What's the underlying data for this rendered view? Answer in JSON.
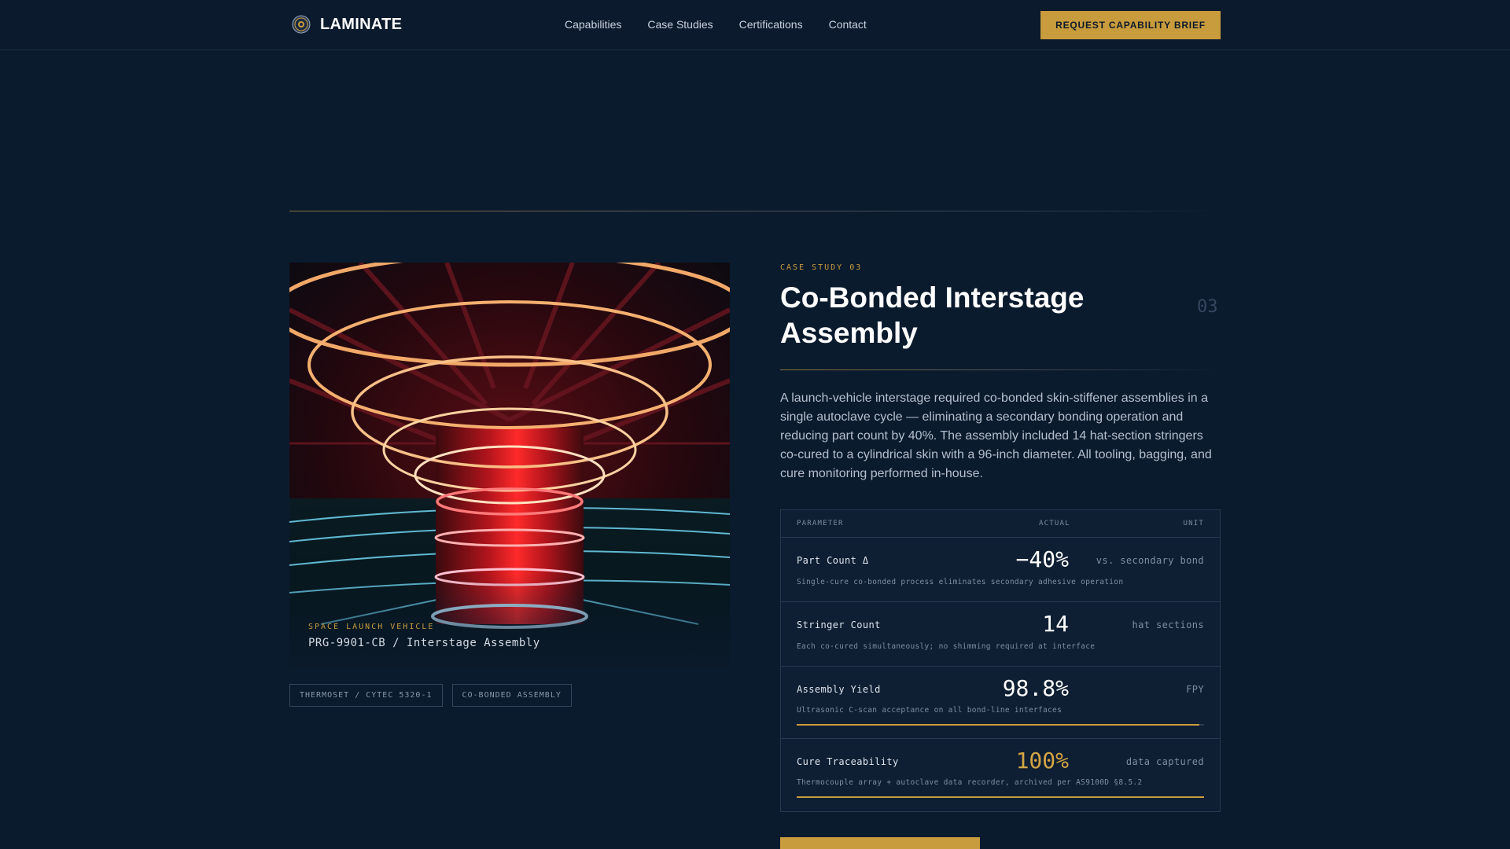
{
  "nav": {
    "brand": "LAMINATE",
    "links": [
      "Capabilities",
      "Case Studies",
      "Certifications",
      "Contact"
    ],
    "cta": "REQUEST CAPABILITY BRIEF"
  },
  "hero": {
    "kicker": "SPACE LAUNCH VEHICLE",
    "caption": "PRG-9901-CB / Interstage Assembly"
  },
  "tags": [
    "THERMOSET / CYTEC 5320-1",
    "CO-BONDED ASSEMBLY"
  ],
  "case": {
    "kicker": "CASE STUDY 03",
    "title": "Co-Bonded Interstage Assembly",
    "index": "03",
    "description": "A launch-vehicle interstage required co-bonded skin-stiffener assemblies in a single autoclave cycle — eliminating a secondary bonding operation and reducing part count by 40%. The assembly included 14 hat-section stringers co-cured to a cylindrical skin with a 96-inch diameter. All tooling, bagging, and cure monitoring performed in-house."
  },
  "table": {
    "headers": {
      "parameter": "PARAMETER",
      "actual": "ACTUAL",
      "unit": "UNIT"
    },
    "rows": [
      {
        "name": "Part Count Δ",
        "value": "−40%",
        "unit": "vs. secondary bond",
        "note": "Single-cure co-bonded process eliminates secondary adhesive operation"
      },
      {
        "name": "Stringer Count",
        "value": "14",
        "unit": "hat sections",
        "note": "Each co-cured simultaneously; no shimming required at interface"
      },
      {
        "name": "Assembly Yield",
        "value": "98.8%",
        "unit": "FPY",
        "note": "Ultrasonic C-scan acceptance on all bond-line interfaces",
        "bar": 0.988
      },
      {
        "name": "Cure Traceability",
        "value": "100%",
        "unit": "data captured",
        "note": "Thermocouple array + autoclave data recorder, archived per AS9100D §8.5.2",
        "bar": 1.0
      }
    ]
  },
  "colors": {
    "background": "#0b1b2e",
    "accent": "#c89b3c",
    "text": "#ffffff",
    "muted": "#7f8da0"
  }
}
